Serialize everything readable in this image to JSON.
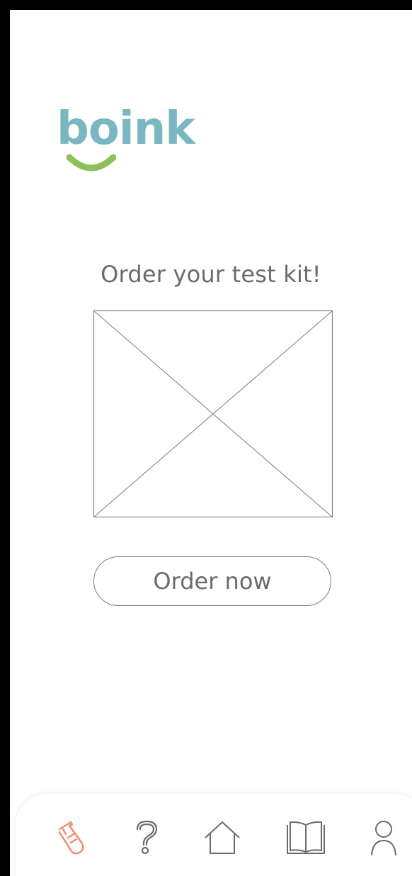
{
  "app": {
    "logo_text": "boink"
  },
  "main": {
    "heading": "Order your test kit!",
    "image_placeholder": "kit-image-placeholder",
    "order_button_label": "Order now"
  },
  "bottom_nav": {
    "items": [
      {
        "icon": "test-tube-icon",
        "active": true
      },
      {
        "icon": "question-mark-icon",
        "active": false
      },
      {
        "icon": "home-icon",
        "active": false
      },
      {
        "icon": "book-icon",
        "active": false
      },
      {
        "icon": "profile-icon",
        "active": false
      }
    ]
  },
  "colors": {
    "logo_blue": "#7bb7c3",
    "logo_green": "#8bc15a",
    "active_icon": "#f0896a",
    "inactive_icon": "#6b6b6b",
    "text_gray": "#6b6b6b"
  }
}
